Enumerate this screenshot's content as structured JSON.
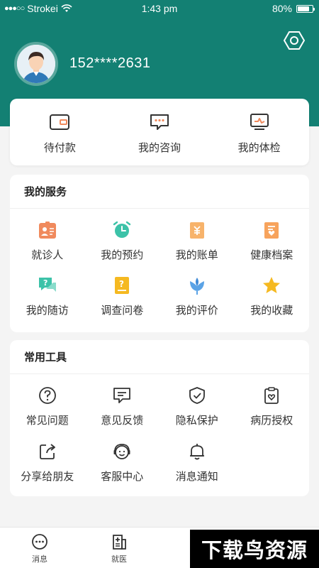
{
  "status_bar": {
    "carrier": "Strokei",
    "signal": "●●●○○",
    "time": "1:43 pm",
    "battery": "80%",
    "battery_level": 0.8
  },
  "profile": {
    "phone": "152****2631",
    "settings_icon": "hexagon-settings-icon"
  },
  "orders": [
    {
      "label": "待付款",
      "icon": "wallet-icon"
    },
    {
      "label": "我的咨询",
      "icon": "chat-icon"
    },
    {
      "label": "我的体检",
      "icon": "monitor-icon"
    }
  ],
  "services": {
    "title": "我的服务",
    "items": [
      {
        "label": "就诊人",
        "icon": "patient-card-icon"
      },
      {
        "label": "我的预约",
        "icon": "alarm-clock-icon"
      },
      {
        "label": "我的账单",
        "icon": "bill-icon"
      },
      {
        "label": "健康档案",
        "icon": "health-record-icon"
      },
      {
        "label": "我的随访",
        "icon": "followup-chat-icon"
      },
      {
        "label": "调查问卷",
        "icon": "questionnaire-icon"
      },
      {
        "label": "我的评价",
        "icon": "flower-icon"
      },
      {
        "label": "我的收藏",
        "icon": "star-icon"
      }
    ]
  },
  "tools": {
    "title": "常用工具",
    "items": [
      {
        "label": "常见问题",
        "icon": "question-icon"
      },
      {
        "label": "意见反馈",
        "icon": "feedback-icon"
      },
      {
        "label": "隐私保护",
        "icon": "shield-check-icon"
      },
      {
        "label": "病历授权",
        "icon": "clipboard-heart-icon"
      },
      {
        "label": "分享给朋友",
        "icon": "share-icon"
      },
      {
        "label": "客服中心",
        "icon": "headset-icon"
      },
      {
        "label": "消息通知",
        "icon": "bell-icon"
      }
    ]
  },
  "bottom_nav": [
    {
      "label": "消息",
      "icon": "message-icon"
    },
    {
      "label": "就医",
      "icon": "hospital-icon"
    }
  ],
  "watermark": "下载鸟资源",
  "colors": {
    "header": "#138073",
    "accent_orange": "#f08a5d",
    "accent_teal": "#3cc2a8",
    "accent_yellow": "#f5b921"
  }
}
